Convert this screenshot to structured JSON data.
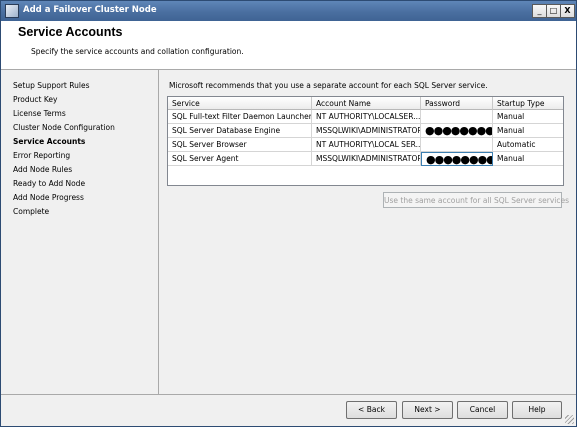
{
  "window": {
    "title": "Add a Failover Cluster Node",
    "controls": {
      "minimize": "_",
      "maximize": "□",
      "close": "X"
    }
  },
  "header": {
    "title": "Service Accounts",
    "subtitle": "Specify the service accounts and collation configuration."
  },
  "nav": {
    "items": [
      {
        "label": "Setup Support Rules"
      },
      {
        "label": "Product Key"
      },
      {
        "label": "License Terms"
      },
      {
        "label": "Cluster Node Configuration"
      },
      {
        "label": "Service Accounts",
        "active": true
      },
      {
        "label": "Error Reporting"
      },
      {
        "label": "Add Node Rules"
      },
      {
        "label": "Ready to Add Node"
      },
      {
        "label": "Add Node Progress"
      },
      {
        "label": "Complete"
      }
    ]
  },
  "main": {
    "recommendation": "Microsoft recommends that you use a separate account for each SQL Server service.",
    "grid": {
      "columns": [
        "Service",
        "Account Name",
        "Password",
        "Startup Type"
      ],
      "rows": [
        {
          "service": "SQL Full-text Filter Daemon Launcher",
          "account": "NT AUTHORITY\\LOCALSER...",
          "password": "",
          "startup": "Manual"
        },
        {
          "service": "SQL Server Database Engine",
          "account": "MSSQLWIKI\\ADMINISTRATOR",
          "password": "●●●●●●●●●●",
          "startup": "Manual"
        },
        {
          "service": "SQL Server Browser",
          "account": "NT AUTHORITY\\LOCAL SER...",
          "password": "",
          "startup": "Automatic"
        },
        {
          "service": "SQL Server Agent",
          "account": "MSSQLWIKI\\ADMINISTRATOR",
          "password": "●●●●●●●●●●",
          "startup": "Manual"
        }
      ]
    },
    "same_account_button": "Use the same account for all SQL Server services"
  },
  "footer": {
    "back": "< Back",
    "next": "Next >",
    "cancel": "Cancel",
    "help": "Help"
  }
}
